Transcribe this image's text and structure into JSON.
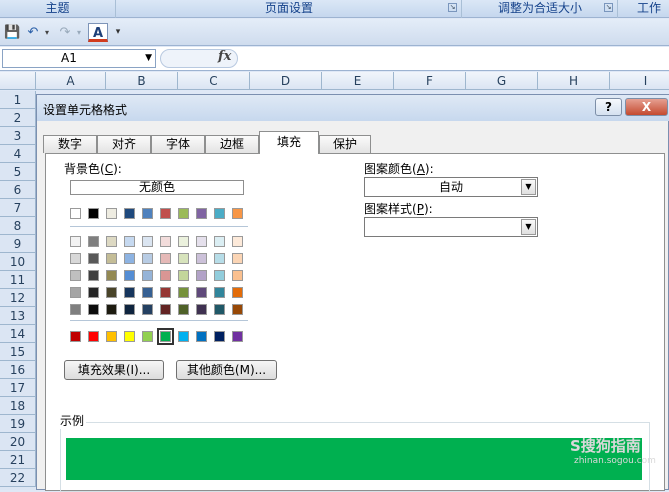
{
  "ribbon": {
    "groups": [
      {
        "label": "主题"
      },
      {
        "label": "页面设置"
      },
      {
        "label": "调整为合适大小"
      },
      {
        "label": "工作"
      }
    ]
  },
  "formula_bar": {
    "name_box": "A1",
    "fx": "fx"
  },
  "sheet": {
    "columns": [
      "A",
      "B",
      "C",
      "D",
      "E",
      "F",
      "G",
      "H",
      "I"
    ],
    "rows": [
      "1",
      "2",
      "3",
      "4",
      "5",
      "6",
      "7",
      "8",
      "9",
      "10",
      "11",
      "12",
      "13",
      "14",
      "15",
      "16",
      "17",
      "18",
      "19",
      "20",
      "21",
      "22"
    ]
  },
  "dialog": {
    "title": "设置单元格格式",
    "help": "?",
    "close": "X",
    "tabs": [
      "数字",
      "对齐",
      "字体",
      "边框",
      "填充",
      "保护"
    ],
    "active_tab": "填充",
    "background_color_label": "背景色",
    "background_color_hotkey": "C",
    "no_color": "无颜色",
    "theme_top_row": [
      "#ffffff",
      "#000000",
      "#eeece1",
      "#1f497d",
      "#4f81bd",
      "#c0504d",
      "#9bbb59",
      "#8064a2",
      "#4bacc6",
      "#f79646"
    ],
    "theme_shades": [
      [
        "#f2f2f2",
        "#7f7f7f",
        "#ddd9c3",
        "#c6d9f0",
        "#dbe5f1",
        "#f2dcdb",
        "#ebf1dd",
        "#e5e0ec",
        "#dbeef3",
        "#fdeada"
      ],
      [
        "#d8d8d8",
        "#595959",
        "#c4bd97",
        "#8db3e2",
        "#b8cce4",
        "#e5b9b7",
        "#d7e3bc",
        "#ccc1d9",
        "#b7dde8",
        "#fbd5b5"
      ],
      [
        "#bfbfbf",
        "#3f3f3f",
        "#938953",
        "#548dd4",
        "#95b3d7",
        "#d99694",
        "#c3d69b",
        "#b2a2c7",
        "#92cddc",
        "#fac08f"
      ],
      [
        "#a5a5a5",
        "#262626",
        "#494429",
        "#17365d",
        "#366092",
        "#953734",
        "#76923c",
        "#5f497a",
        "#31859b",
        "#e36c09"
      ],
      [
        "#7f7f7f",
        "#0c0c0c",
        "#1d1b10",
        "#0f243e",
        "#244061",
        "#632423",
        "#4f6128",
        "#3f3151",
        "#205867",
        "#974806"
      ]
    ],
    "standard_colors": [
      "#c00000",
      "#ff0000",
      "#ffc000",
      "#ffff00",
      "#92d050",
      "#00b050",
      "#00b0f0",
      "#0070c0",
      "#002060",
      "#7030a0"
    ],
    "selected_standard_index": 5,
    "fill_effects_button": "填充效果(I)...",
    "more_colors_button": "其他颜色(M)...",
    "pattern_color_label": "图案颜色",
    "pattern_color_hotkey": "A",
    "pattern_color_value": "自动",
    "pattern_style_label": "图案样式",
    "pattern_style_hotkey": "P",
    "pattern_style_value": "",
    "sample_label": "示例",
    "sample_color": "#00b050"
  },
  "watermark": {
    "brand": "S搜狗指南",
    "url": "zhinan.sogou.com"
  }
}
